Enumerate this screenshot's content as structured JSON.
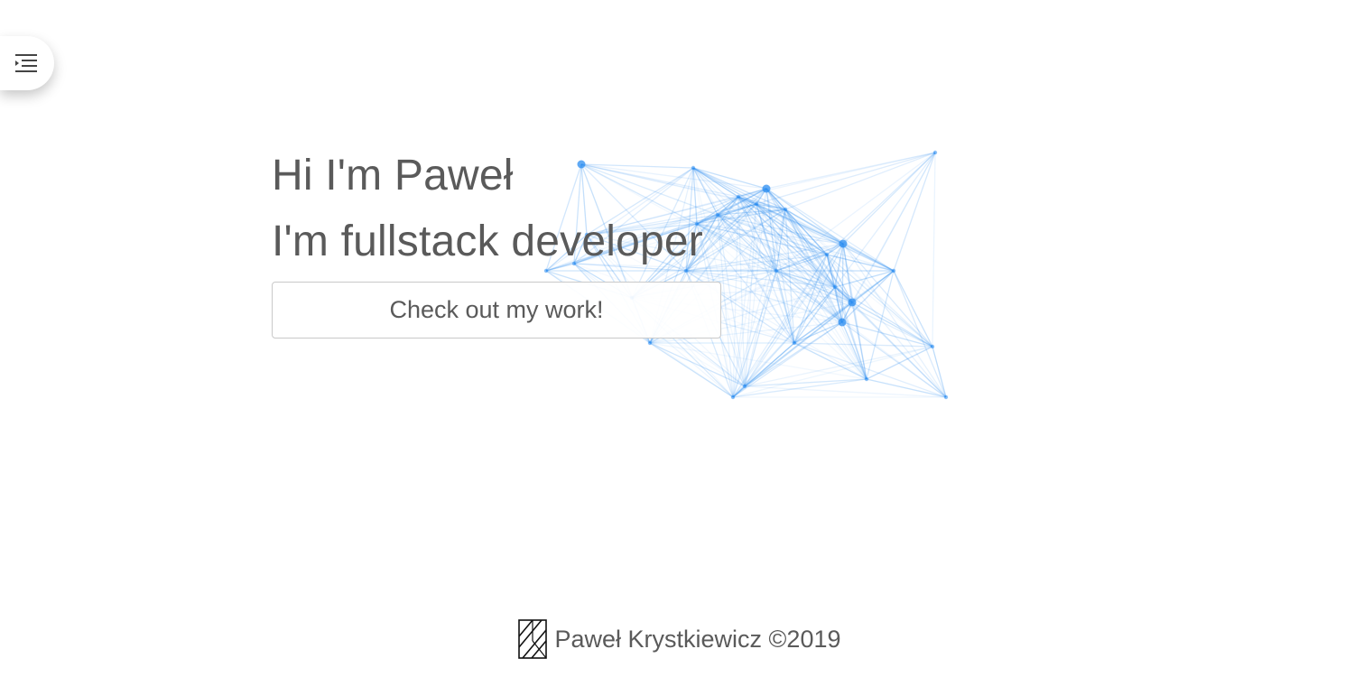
{
  "nav": {
    "menu_icon": "menu-indent-icon"
  },
  "hero": {
    "greeting": "Hi I'm Paweł",
    "role": "I'm fullstack developer",
    "cta_label": "Check out my work!"
  },
  "decoration": {
    "network_icon": "network-graph-icon",
    "accent_color": "#2a8cf0"
  },
  "footer": {
    "logo_icon": "striped-logo-icon",
    "text": "Paweł Krystkiewicz ©2019"
  }
}
